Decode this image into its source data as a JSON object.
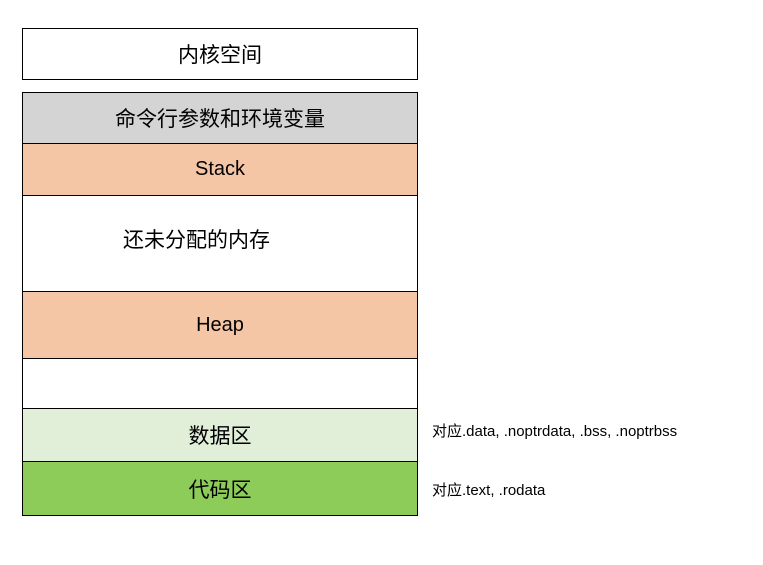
{
  "kernel": {
    "label": "内核空间",
    "color": "#ffffff"
  },
  "segments": {
    "env": {
      "label": "命令行参数和环境变量",
      "color": "#d4d4d4"
    },
    "stack": {
      "label": "Stack",
      "color": "#f4c6a6"
    },
    "unallocated": {
      "label": "还未分配的内存",
      "color": "#ffffff"
    },
    "heap": {
      "label": "Heap",
      "color": "#f4c6a6"
    },
    "gap": {
      "label": "",
      "color": "#ffffff"
    },
    "data": {
      "label": "数据区",
      "color": "#e1eed8"
    },
    "code": {
      "label": "代码区",
      "color": "#8dcc58"
    }
  },
  "notes": {
    "data": "对应.data, .noptrdata, .bss, .noptrbss",
    "code": "对应.text, .rodata"
  }
}
